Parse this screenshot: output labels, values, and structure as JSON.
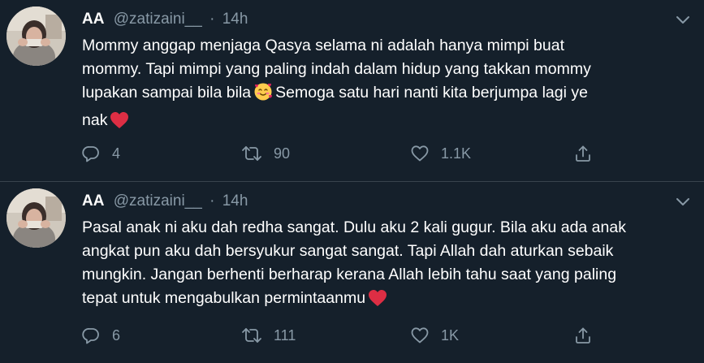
{
  "tweets": [
    {
      "name": "AA",
      "handle": "@zatizaini__",
      "separator": "·",
      "time": "14h",
      "lines": [
        "Mommy anggap menjaga Qasya selama ni adalah hanya mimpi buat",
        "mommy. Tapi mimpi yang paling indah dalam hidup yang takkan mommy",
        "lupakan sampai bila bila",
        "Semoga satu hari nanti kita berjumpa lagi ye",
        "nak"
      ],
      "emojis": [
        "smiling-face-with-hearts-emoji",
        "red-heart-emoji"
      ],
      "replies": "4",
      "retweets": "90",
      "likes": "1.1K"
    },
    {
      "name": "AA",
      "handle": "@zatizaini__",
      "separator": "·",
      "time": "14h",
      "lines": [
        "Pasal anak ni aku dah redha sangat. Dulu aku 2 kali gugur. Bila aku ada anak",
        "angkat pun aku dah bersyukur sangat sangat. Tapi Allah dah aturkan sebaik",
        "mungkin. Jangan berhenti berharap kerana Allah lebih tahu saat yang paling",
        "tepat untuk mengabulkan permintaanmu"
      ],
      "emojis": [
        "red-heart-emoji"
      ],
      "replies": "6",
      "retweets": "111",
      "likes": "1K"
    }
  ],
  "icons": {
    "reply": "reply-icon",
    "retweet": "retweet-icon",
    "like": "like-icon",
    "share": "share-icon",
    "more": "chevron-down-icon"
  },
  "colors": {
    "background": "#15202b",
    "text": "#ffffff",
    "secondary": "#8899a6",
    "divider": "#38444d",
    "heart": "#e0245e"
  }
}
